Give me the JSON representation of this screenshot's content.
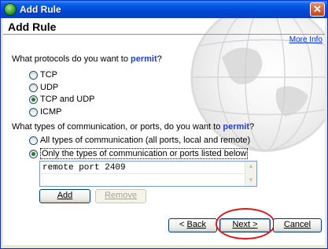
{
  "window": {
    "title": "Add Rule"
  },
  "header": {
    "title": "Add Rule",
    "more_info": "More Info"
  },
  "protocols": {
    "question_prefix": "What protocols do you want to ",
    "question_accent": "permit",
    "question_suffix": "?",
    "options": [
      {
        "label": "TCP",
        "checked": false
      },
      {
        "label": "UDP",
        "checked": false
      },
      {
        "label": "TCP and UDP",
        "checked": true
      },
      {
        "label": "ICMP",
        "checked": false
      }
    ]
  },
  "ports": {
    "question_prefix": "What types of communication, or ports, do you want to ",
    "question_accent": "permit",
    "question_suffix": "?",
    "options": [
      {
        "label": "All types of communication (all ports, local and remote)",
        "checked": false
      },
      {
        "label": "Only the types of communication or ports listed below",
        "checked": true
      }
    ],
    "list_items": [
      "remote port 2409"
    ]
  },
  "buttons": {
    "add": "Add",
    "remove": "Remove",
    "back_prefix": "< ",
    "back": "Back",
    "next": "Next >",
    "cancel": "Cancel"
  },
  "icons": {
    "app": "globe-shield-icon",
    "close": "close-icon"
  }
}
